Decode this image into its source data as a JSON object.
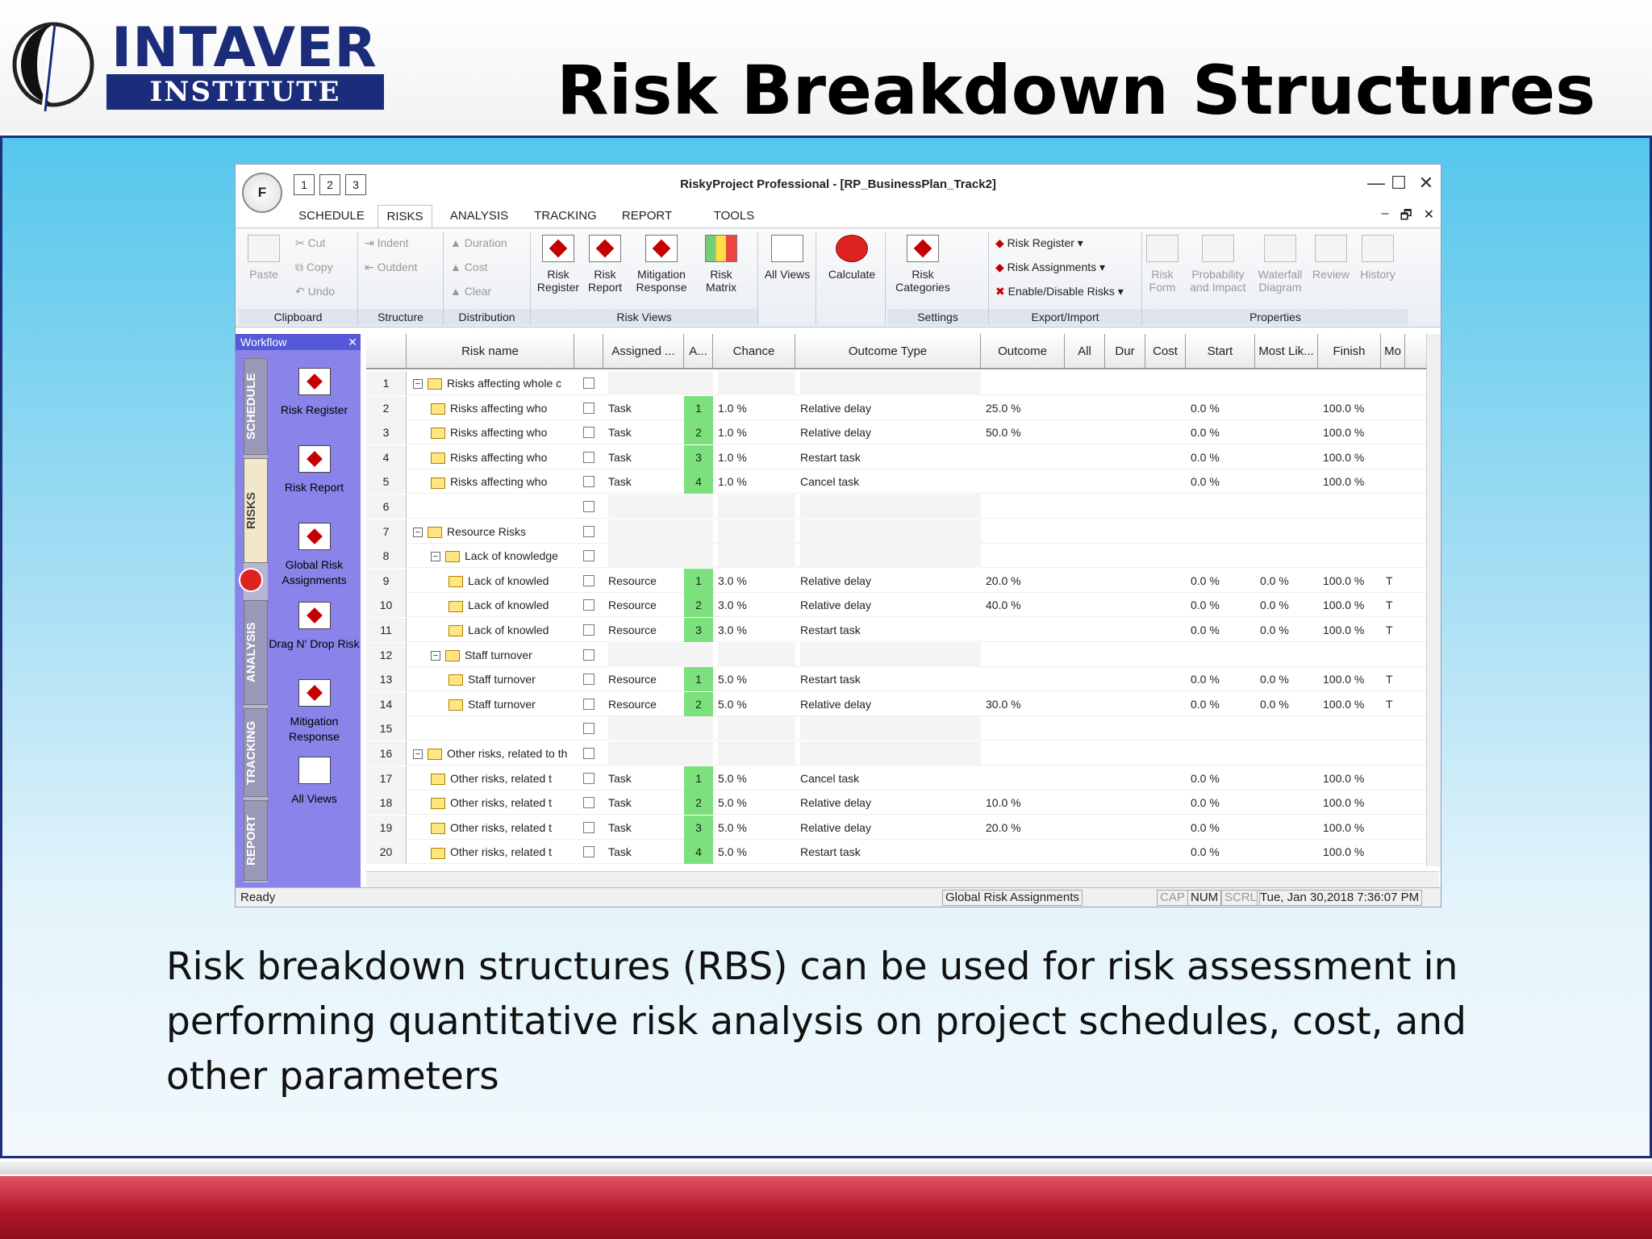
{
  "slide": {
    "logo": {
      "line1": "INTAVER",
      "line2": "INSTITUTE"
    },
    "title": "Risk Breakdown Structures",
    "caption": "Risk breakdown structures (RBS) can be used for risk assessment in performing quantitative risk analysis on project schedules, cost, and other parameters"
  },
  "app": {
    "window_title": "RiskyProject Professional - [RP_BusinessPlan_Track2]",
    "app_button": "F",
    "qat": [
      "1",
      "2",
      "3"
    ],
    "tabs": [
      "SCHEDULE",
      "RISKS",
      "ANALYSIS",
      "TRACKING",
      "REPORT",
      "TOOLS"
    ],
    "active_tab": "RISKS",
    "window_controls": {
      "minimize": "—",
      "maximize": "☐",
      "close": "✕"
    },
    "mdi_controls": {
      "minimize": "–",
      "restore": "🗗",
      "close": "✕"
    },
    "ribbon": {
      "clipboard": {
        "label": "Clipboard",
        "paste": "Paste",
        "cut": "Cut",
        "copy": "Copy",
        "undo": "Undo"
      },
      "structure": {
        "label": "Structure",
        "indent": "Indent",
        "outdent": "Outdent"
      },
      "distribution": {
        "label": "Distribution",
        "duration": "Duration",
        "cost": "Cost",
        "clear": "Clear"
      },
      "risk_views": {
        "label": "Risk Views",
        "risk_register": "Risk Register",
        "risk_report": "Risk Report",
        "mitigation_response": "Mitigation Response",
        "risk_matrix": "Risk Matrix"
      },
      "all_views": "All Views",
      "calculate": "Calculate",
      "settings": {
        "label": "Settings",
        "risk_categories": "Risk Categories"
      },
      "export_import": {
        "label": "Export/Import",
        "risk_register": "Risk Register",
        "risk_assignments": "Risk Assignments",
        "enable_disable": "Enable/Disable Risks"
      },
      "properties": {
        "label": "Properties",
        "risk_form": "Risk Form",
        "probability_impact": "Probability and Impact",
        "waterfall": "Waterfall Diagram",
        "review": "Review",
        "history": "History"
      }
    },
    "workflow": {
      "title": "Workflow",
      "close": "✕",
      "side_tabs": [
        "SCHEDULE",
        "RISKS",
        "ANALYSIS",
        "TRACKING",
        "REPORT"
      ],
      "items": [
        "Risk Register",
        "Risk Report",
        "Global Risk Assignments",
        "Drag N' Drop Risk",
        "Mitigation Response",
        "All Views"
      ]
    },
    "grid": {
      "columns": [
        "Risk name",
        "",
        "Assigned ...",
        "A...",
        "Chance",
        "Outcome Type",
        "Outcome",
        "All",
        "Dur",
        "Cost",
        "Start",
        "Most Lik...",
        "Finish",
        "Mo"
      ],
      "rows": [
        {
          "n": "1",
          "level": 0,
          "group": true,
          "name": "Risks affecting whole c",
          "assigned": "",
          "a": "",
          "chance": "",
          "otype": "",
          "outcome": "",
          "start": "",
          "most": "",
          "finish": "",
          "mo": ""
        },
        {
          "n": "2",
          "level": 1,
          "group": false,
          "name": "Risks affecting who",
          "assigned": "Task",
          "a": "1",
          "chance": "1.0 %",
          "otype": "Relative delay",
          "outcome": "25.0 %",
          "start": "0.0 %",
          "most": "",
          "finish": "100.0 %",
          "mo": ""
        },
        {
          "n": "3",
          "level": 1,
          "group": false,
          "name": "Risks affecting who",
          "assigned": "Task",
          "a": "2",
          "chance": "1.0 %",
          "otype": "Relative delay",
          "outcome": "50.0 %",
          "start": "0.0 %",
          "most": "",
          "finish": "100.0 %",
          "mo": ""
        },
        {
          "n": "4",
          "level": 1,
          "group": false,
          "name": "Risks affecting who",
          "assigned": "Task",
          "a": "3",
          "chance": "1.0 %",
          "otype": "Restart task",
          "outcome": "",
          "start": "0.0 %",
          "most": "",
          "finish": "100.0 %",
          "mo": ""
        },
        {
          "n": "5",
          "level": 1,
          "group": false,
          "name": "Risks affecting who",
          "assigned": "Task",
          "a": "4",
          "chance": "1.0 %",
          "otype": "Cancel task",
          "outcome": "",
          "start": "0.0 %",
          "most": "",
          "finish": "100.0 %",
          "mo": ""
        },
        {
          "n": "6",
          "level": -1,
          "group": false,
          "name": "",
          "assigned": "",
          "a": "",
          "chance": "",
          "otype": "",
          "outcome": "",
          "start": "",
          "most": "",
          "finish": "",
          "mo": ""
        },
        {
          "n": "7",
          "level": 0,
          "group": true,
          "name": "Resource Risks",
          "assigned": "",
          "a": "",
          "chance": "",
          "otype": "",
          "outcome": "",
          "start": "",
          "most": "",
          "finish": "",
          "mo": ""
        },
        {
          "n": "8",
          "level": 1,
          "group": true,
          "name": "Lack of knowledge",
          "assigned": "",
          "a": "",
          "chance": "",
          "otype": "",
          "outcome": "",
          "start": "",
          "most": "",
          "finish": "",
          "mo": ""
        },
        {
          "n": "9",
          "level": 2,
          "group": false,
          "name": "Lack of knowled",
          "assigned": "Resource",
          "a": "1",
          "chance": "3.0 %",
          "otype": "Relative delay",
          "outcome": "20.0 %",
          "start": "0.0 %",
          "most": "0.0 %",
          "finish": "100.0 %",
          "mo": "T"
        },
        {
          "n": "10",
          "level": 2,
          "group": false,
          "name": "Lack of knowled",
          "assigned": "Resource",
          "a": "2",
          "chance": "3.0 %",
          "otype": "Relative delay",
          "outcome": "40.0 %",
          "start": "0.0 %",
          "most": "0.0 %",
          "finish": "100.0 %",
          "mo": "T"
        },
        {
          "n": "11",
          "level": 2,
          "group": false,
          "name": "Lack of knowled",
          "assigned": "Resource",
          "a": "3",
          "chance": "3.0 %",
          "otype": "Restart task",
          "outcome": "",
          "start": "0.0 %",
          "most": "0.0 %",
          "finish": "100.0 %",
          "mo": "T"
        },
        {
          "n": "12",
          "level": 1,
          "group": true,
          "name": "Staff turnover",
          "assigned": "",
          "a": "",
          "chance": "",
          "otype": "",
          "outcome": "",
          "start": "",
          "most": "",
          "finish": "",
          "mo": ""
        },
        {
          "n": "13",
          "level": 2,
          "group": false,
          "name": "Staff turnover",
          "assigned": "Resource",
          "a": "1",
          "chance": "5.0 %",
          "otype": "Restart task",
          "outcome": "",
          "start": "0.0 %",
          "most": "0.0 %",
          "finish": "100.0 %",
          "mo": "T"
        },
        {
          "n": "14",
          "level": 2,
          "group": false,
          "name": "Staff turnover",
          "assigned": "Resource",
          "a": "2",
          "chance": "5.0 %",
          "otype": "Relative delay",
          "outcome": "30.0 %",
          "start": "0.0 %",
          "most": "0.0 %",
          "finish": "100.0 %",
          "mo": "T"
        },
        {
          "n": "15",
          "level": -1,
          "group": false,
          "name": "",
          "assigned": "",
          "a": "",
          "chance": "",
          "otype": "",
          "outcome": "",
          "start": "",
          "most": "",
          "finish": "",
          "mo": ""
        },
        {
          "n": "16",
          "level": 0,
          "group": true,
          "name": "Other risks, related to th",
          "assigned": "",
          "a": "",
          "chance": "",
          "otype": "",
          "outcome": "",
          "start": "",
          "most": "",
          "finish": "",
          "mo": ""
        },
        {
          "n": "17",
          "level": 1,
          "group": false,
          "name": "Other risks, related t",
          "assigned": "Task",
          "a": "1",
          "chance": "5.0 %",
          "otype": "Cancel task",
          "outcome": "",
          "start": "0.0 %",
          "most": "",
          "finish": "100.0 %",
          "mo": ""
        },
        {
          "n": "18",
          "level": 1,
          "group": false,
          "name": "Other risks, related t",
          "assigned": "Task",
          "a": "2",
          "chance": "5.0 %",
          "otype": "Relative delay",
          "outcome": "10.0 %",
          "start": "0.0 %",
          "most": "",
          "finish": "100.0 %",
          "mo": ""
        },
        {
          "n": "19",
          "level": 1,
          "group": false,
          "name": "Other risks, related t",
          "assigned": "Task",
          "a": "3",
          "chance": "5.0 %",
          "otype": "Relative delay",
          "outcome": "20.0 %",
          "start": "0.0 %",
          "most": "",
          "finish": "100.0 %",
          "mo": ""
        },
        {
          "n": "20",
          "level": 1,
          "group": false,
          "name": "Other risks, related t",
          "assigned": "Task",
          "a": "4",
          "chance": "5.0 %",
          "otype": "Restart task",
          "outcome": "",
          "start": "0.0 %",
          "most": "",
          "finish": "100.0 %",
          "mo": ""
        }
      ]
    },
    "statusbar": {
      "ready": "Ready",
      "view": "Global Risk Assignments",
      "cap": "CAP",
      "num": "NUM",
      "scrl": "SCRL",
      "datetime": "Tue, Jan 30,2018 7:36:07 PM"
    }
  },
  "colors": {
    "header_navy": "#1b2d7a",
    "accent_red": "#b01528",
    "slide_blue": "#55c7ec",
    "workflow_purple": "#8a84ea",
    "group_green": "#7ce07c"
  }
}
